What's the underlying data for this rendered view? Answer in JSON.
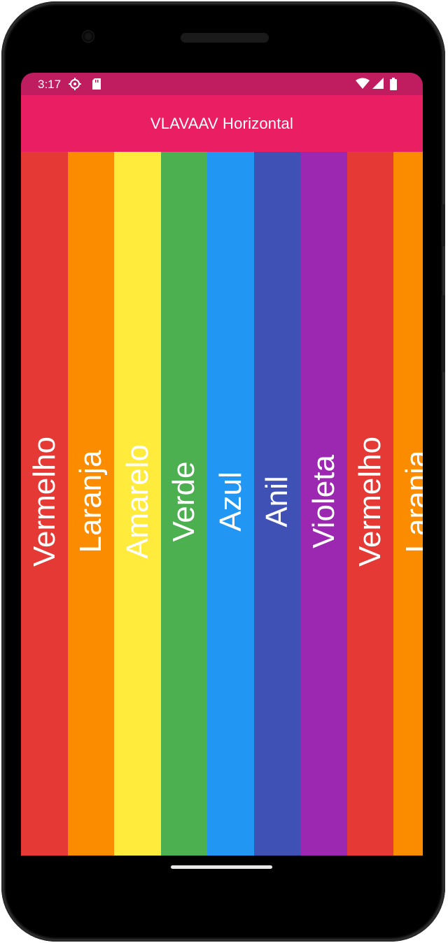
{
  "status_bar": {
    "time": "3:17",
    "left_icons": [
      "settings-icon",
      "sd-card-icon"
    ],
    "right_icons": [
      "wifi-icon",
      "signal-icon",
      "battery-icon"
    ],
    "color": "#bf1d5f"
  },
  "app_bar": {
    "title": "VLAVAAV Horizontal",
    "color": "#e91e63"
  },
  "strips": [
    {
      "label": "Vermelho",
      "color": "#e53935"
    },
    {
      "label": "Laranja",
      "color": "#fb8c00"
    },
    {
      "label": "Amarelo",
      "color": "#ffeb3b"
    },
    {
      "label": "Verde",
      "color": "#4caf50"
    },
    {
      "label": "Azul",
      "color": "#2196f3"
    },
    {
      "label": "Anil",
      "color": "#3f51b5"
    },
    {
      "label": "Violeta",
      "color": "#9c27b0"
    },
    {
      "label": "Vermelho",
      "color": "#e53935"
    },
    {
      "label": "Laranja",
      "color": "#fb8c00"
    }
  ]
}
